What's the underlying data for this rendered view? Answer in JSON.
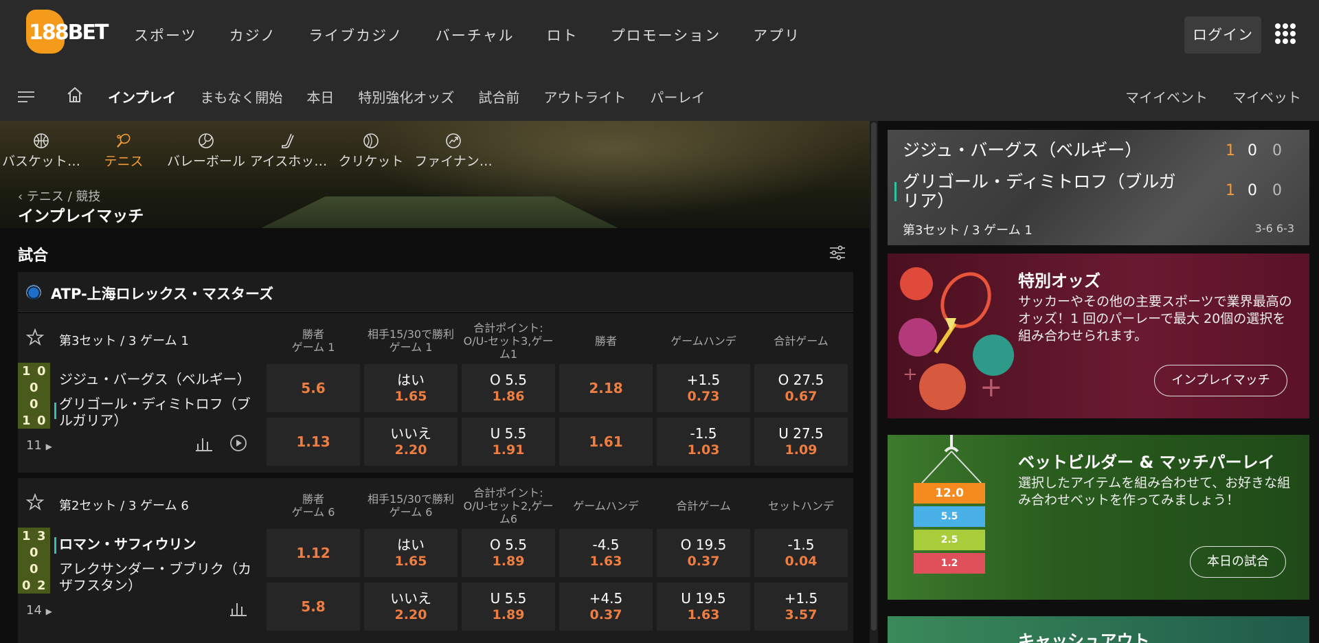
{
  "logo": {
    "text": "188BET"
  },
  "topnav": [
    "スポーツ",
    "カジノ",
    "ライブカジノ",
    "バーチャル",
    "ロト",
    "プロモーション",
    "アプリ"
  ],
  "login_label": "ログイン",
  "subnav": {
    "items": [
      "インプレイ",
      "まもなく開始",
      "本日",
      "特別強化オッズ",
      "試合前",
      "アウトライト",
      "パーレイ"
    ],
    "right": [
      "マイイベント",
      "マイベット"
    ]
  },
  "sports": [
    {
      "label": "バスケット…",
      "icon": "basketball-icon"
    },
    {
      "label": "テニス",
      "icon": "tennis-icon"
    },
    {
      "label": "バレーボール",
      "icon": "volleyball-icon"
    },
    {
      "label": "アイスホッ…",
      "icon": "ice-hockey-icon"
    },
    {
      "label": "クリケット",
      "icon": "cricket-icon"
    },
    {
      "label": "ファイナン…",
      "icon": "finance-icon"
    }
  ],
  "breadcrumb": "テニス / 競技",
  "page_title": "インプレイマッチ",
  "section_title": "試合",
  "league": "ATP-上海ロレックス・マスターズ",
  "matches": [
    {
      "set": "第3セット / 3 ゲーム 1",
      "columns": [
        "勝者\nゲーム 1",
        "相手15/30で勝利\nゲーム 1",
        "合計ポイント:\nO/U-セット3,ゲー\nム1",
        "勝者",
        "ゲームハンデ",
        "合計ゲーム"
      ],
      "score": {
        "p1": [
          "1",
          "0"
        ],
        "mid": [
          "0",
          "0"
        ],
        "p2": [
          "1",
          "0"
        ]
      },
      "player1": "ジジュ・バーグス（ベルギー）",
      "player2": "グリゴール・ディミトロフ（ブルガリア）",
      "more": "11",
      "rows": [
        [
          {
            "v": "5.6"
          },
          {
            "l": "はい",
            "v": "1.65"
          },
          {
            "l": "O 5.5",
            "v": "1.86"
          },
          {
            "v": "2.18"
          },
          {
            "l": "+1.5",
            "v": "0.73"
          },
          {
            "l": "O 27.5",
            "v": "0.67"
          }
        ],
        [
          {
            "v": "1.13"
          },
          {
            "l": "いいえ",
            "v": "2.20"
          },
          {
            "l": "U 5.5",
            "v": "1.91"
          },
          {
            "v": "1.61"
          },
          {
            "l": "-1.5",
            "v": "1.03"
          },
          {
            "l": "U 27.5",
            "v": "1.09"
          }
        ]
      ]
    },
    {
      "set": "第2セット / 3 ゲーム 6",
      "columns": [
        "勝者\nゲーム 6",
        "相手15/30で勝利\nゲーム 6",
        "合計ポイント:\nO/U-セット2,ゲー\nム6",
        "ゲームハンデ",
        "合計ゲーム",
        "セットハンデ"
      ],
      "score": {
        "p1": [
          "1",
          "3"
        ],
        "mid": [
          "0",
          "0"
        ],
        "p2": [
          "0",
          "2"
        ]
      },
      "player1": "ロマン・サフィウリン",
      "player2": "アレクサンダー・ブブリク（カザフスタン）",
      "more": "14",
      "rows": [
        [
          {
            "v": "1.12"
          },
          {
            "l": "はい",
            "v": "1.65"
          },
          {
            "l": "O 5.5",
            "v": "1.89"
          },
          {
            "l": "-4.5",
            "v": "1.63"
          },
          {
            "l": "O 19.5",
            "v": "0.37"
          },
          {
            "l": "-1.5",
            "v": "0.04"
          }
        ],
        [
          {
            "v": "5.8"
          },
          {
            "l": "いいえ",
            "v": "2.20"
          },
          {
            "l": "U 5.5",
            "v": "1.89"
          },
          {
            "l": "+4.5",
            "v": "0.37"
          },
          {
            "l": "U 19.5",
            "v": "1.63"
          },
          {
            "l": "+1.5",
            "v": "3.57"
          }
        ]
      ]
    }
  ],
  "live": {
    "player1": "ジジュ・バーグス（ベルギー）",
    "player2": "グリゴール・ディミトロフ（ブルガリア）",
    "p1_scores": [
      "1",
      "0",
      "0"
    ],
    "p2_scores": [
      "1",
      "0",
      "0"
    ],
    "footer": "第3セット / 3 ゲーム 1",
    "sets": "3-6 6-3"
  },
  "promos": [
    {
      "title": "特別オッズ",
      "desc": "サッカーやその他の主要スポーツで業界最高のオッズ！1 回のパーレーで最大 20個の選択を組み合わせられます。",
      "button": "インプレイマッチ"
    },
    {
      "title": "ベットビルダー & マッチパーレイ",
      "desc": "選択したアイテムを組み合わせて、お好きな組み合わせベットを作ってみましょう！",
      "button": "本日の試合",
      "chips": [
        "12.0",
        "5.5",
        "2.5",
        "1.2"
      ]
    },
    {
      "title": "キャッシュアウト"
    }
  ],
  "colors": {
    "accent": "#f07e42",
    "orange": "#f39b3a",
    "live_bar": "#2fc3a2",
    "promo1_bg": "#5a1426",
    "promo2_bg": "#2a5c1e"
  }
}
